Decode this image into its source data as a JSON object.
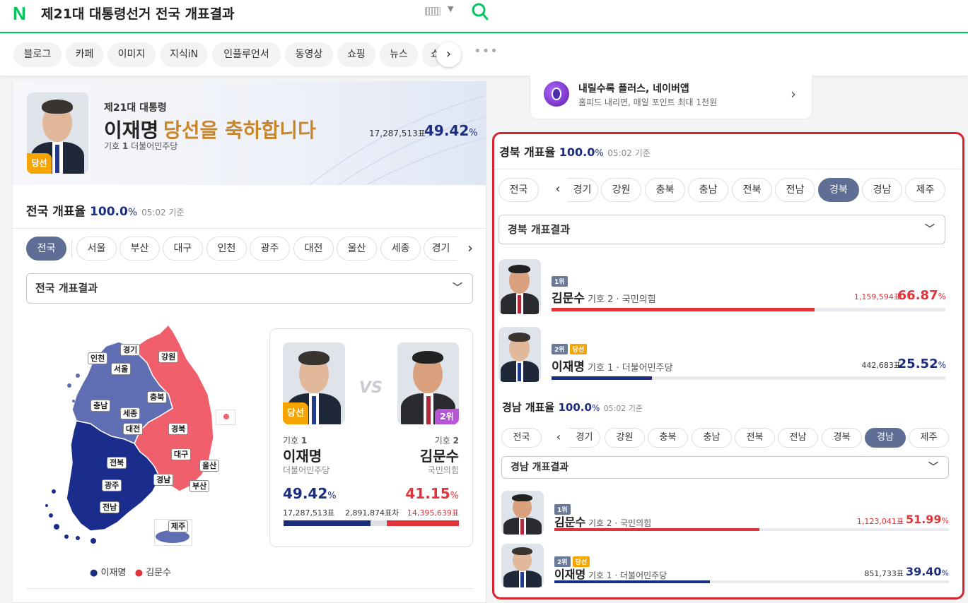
{
  "header": {
    "logo": "N",
    "query": "제21대 대통령선거 전국 개표결과"
  },
  "tabs": [
    "블로그",
    "카페",
    "이미지",
    "지식iN",
    "인플루언서",
    "동영상",
    "쇼핑",
    "뉴스",
    "쇼"
  ],
  "banner": {
    "subtitle": "제21대 대통령",
    "name": "이재명",
    "congrats": "당선을 축하합니다",
    "symbol_label": "기호",
    "symbol_no": "1",
    "party": "더불어민주당",
    "votes": "17,287,513표",
    "percent": "49.42",
    "pct_unit": "%",
    "win_badge": "당선"
  },
  "national": {
    "title": "전국 개표율",
    "rate": "100.0",
    "rate_unit": "%",
    "time": "05:02 기준",
    "regions": [
      "전국",
      "서울",
      "부산",
      "대구",
      "인천",
      "광주",
      "대전",
      "울산",
      "세종",
      "경기"
    ],
    "active_region": "전국",
    "dropdown": "전국 개표결과",
    "map_labels": [
      "인천",
      "경기",
      "강원",
      "서울",
      "충남",
      "세종",
      "충북",
      "대전",
      "경북",
      "대구",
      "울산",
      "전북",
      "경남",
      "부산",
      "광주",
      "전남",
      "제주"
    ],
    "legend": [
      "이재명",
      "김문수"
    ],
    "colors": {
      "lee": "#1b2d7e",
      "kim": "#e0333a",
      "lee_map": "#5f6eb2",
      "kim_map": "#ef5f6c",
      "lee_strong": "#1b2d8c"
    }
  },
  "versus": {
    "vs": "VS",
    "left": {
      "symbol_label": "기호",
      "symbol_no": "1",
      "name": "이재명",
      "party": "더불어민주당",
      "percent": "49.42",
      "votes": "17,287,513표",
      "win_badge": "당선",
      "share": 0.4942
    },
    "right": {
      "symbol_label": "기호",
      "symbol_no": "2",
      "name": "김문수",
      "party": "국민의힘",
      "percent": "41.15",
      "votes": "14,395,639표",
      "rank_badge": "2위",
      "share": 0.4115
    },
    "diff": "2,891,874표차",
    "pct_unit": "%"
  },
  "promo": {
    "title": "내릴수록 플러스, 네이버앱",
    "subtitle": "홈피드 내리면, 매일 포인트 최대 1천원"
  },
  "gyeongbuk": {
    "title": "경북 개표율",
    "rate": "100.0",
    "rate_unit": "%",
    "time": "05:02 기준",
    "regions": [
      "전국",
      "경기",
      "강원",
      "충북",
      "충남",
      "전북",
      "전남",
      "경북",
      "경남",
      "제주"
    ],
    "active_region": "경북",
    "dropdown": "경북 개표결과",
    "candidates": [
      {
        "rank": "1위",
        "name": "김문수",
        "symbol": "기호 2",
        "party": "국민의힘",
        "votes": "1,159,594표",
        "percent": "66.87",
        "share": 0.6687,
        "winner": false
      },
      {
        "rank": "2위",
        "win": "당선",
        "name": "이재명",
        "symbol": "기호 1",
        "party": "더불어민주당",
        "votes": "442,683표",
        "percent": "25.52",
        "share": 0.2552,
        "winner": true
      }
    ]
  },
  "gyeongnam": {
    "title": "경남 개표율",
    "rate": "100.0",
    "rate_unit": "%",
    "time": "05:02 기준",
    "regions": [
      "전국",
      "경기",
      "강원",
      "충북",
      "충남",
      "전북",
      "전남",
      "경북",
      "경남",
      "제주"
    ],
    "active_region": "경남",
    "dropdown": "경남 개표결과",
    "candidates": [
      {
        "rank": "1위",
        "name": "김문수",
        "symbol": "기호 2",
        "party": "국민의힘",
        "votes": "1,123,041표",
        "percent": "51.99",
        "share": 0.5199,
        "winner": false
      },
      {
        "rank": "2위",
        "win": "당선",
        "name": "이재명",
        "symbol": "기호 1",
        "party": "더불어민주당",
        "votes": "851,733표",
        "percent": "39.40",
        "share": 0.394,
        "winner": true
      }
    ]
  }
}
